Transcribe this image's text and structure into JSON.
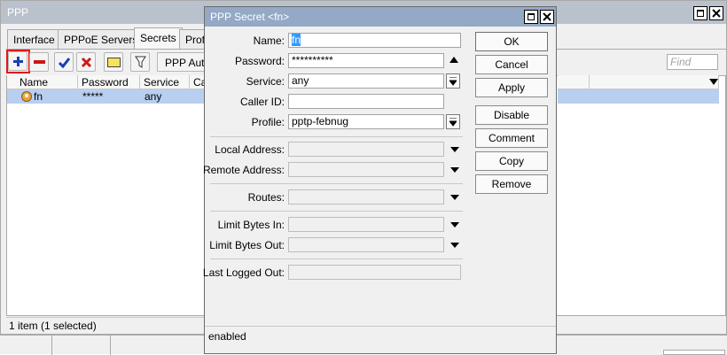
{
  "ppp_window": {
    "title": "PPP",
    "tabs": [
      "Interface",
      "PPPoE Servers",
      "Secrets",
      "Profil"
    ],
    "active_tab": "Secrets",
    "auth_button_label": "PPP Auth",
    "find_placeholder": "Find",
    "table": {
      "columns": [
        "Name",
        "Password",
        "Service",
        "Ca"
      ],
      "rows": [
        {
          "name": "fn",
          "password": "*****",
          "service": "any"
        }
      ]
    },
    "status": "1 item (1 selected)"
  },
  "dialog": {
    "title": "PPP Secret <fn>",
    "fields": {
      "name": {
        "label": "Name:",
        "value": "fn"
      },
      "password": {
        "label": "Password:",
        "value": "**********"
      },
      "service": {
        "label": "Service:",
        "value": "any"
      },
      "caller_id": {
        "label": "Caller ID:",
        "value": ""
      },
      "profile": {
        "label": "Profile:",
        "value": "pptp-febnug"
      },
      "local_address": {
        "label": "Local Address:",
        "value": ""
      },
      "remote_address": {
        "label": "Remote Address:",
        "value": ""
      },
      "routes": {
        "label": "Routes:",
        "value": ""
      },
      "limit_bytes_in": {
        "label": "Limit Bytes In:",
        "value": ""
      },
      "limit_bytes_out": {
        "label": "Limit Bytes Out:",
        "value": ""
      },
      "last_logged_out": {
        "label": "Last Logged Out:",
        "value": ""
      }
    },
    "buttons": {
      "ok": "OK",
      "cancel": "Cancel",
      "apply": "Apply",
      "disable": "Disable",
      "comment": "Comment",
      "copy": "Copy",
      "remove": "Remove"
    },
    "status": "enabled"
  },
  "colors": {
    "add_icon": "#1a3fb0",
    "remove_icon": "#c81818",
    "check_icon": "#1a3fb0",
    "x_icon": "#d01818",
    "highlight": "#e01818",
    "selected_row": "#b8cff0"
  },
  "icons": [
    "add-icon",
    "remove-icon",
    "enable-icon",
    "disable-icon",
    "comment-icon",
    "filter-icon",
    "user-icon",
    "dropdown-arrow-icon",
    "up-arrow-icon"
  ]
}
